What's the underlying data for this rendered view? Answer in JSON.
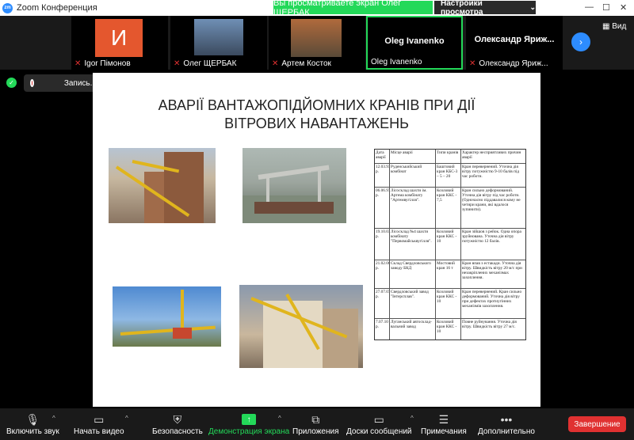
{
  "window": {
    "title": "Zoom Конференция",
    "app_icon": "zm"
  },
  "share_banner": "Вы просматриваете экран Олег ЩЕРБАК",
  "view_settings": "Настройки просмотра",
  "view_label": "Вид",
  "participants": [
    {
      "name": "Igor Пімонов",
      "initial": "И",
      "muted": true
    },
    {
      "name": "Олег ЩЕРБАК",
      "muted": true
    },
    {
      "name": "Артем Косток",
      "muted": true
    },
    {
      "name": "Oleg Ivanenko",
      "display": "Oleg Ivanenko",
      "muted": false
    },
    {
      "name": "Олександр Яриж...",
      "display": "Олександр Яриж...",
      "caption": "Олександр Яриж..."
    }
  ],
  "participant_labels": {
    "p4_caption": "Oleg Ivanenko",
    "p5_caption": "Олександр Яриж..."
  },
  "recording": {
    "label": "Запись..."
  },
  "slide": {
    "title_line1": "АВАРІЇ ВАНТАЖОПІДЙОМНИХ КРАНІВ ПРИ ДІЇ",
    "title_line2": "ВІТРОВИХ НАВАНТАЖЕНЬ",
    "table": {
      "headers": [
        "Дата аварії",
        "Місце аварії",
        "Типи кранів",
        "Характер несприятливих причин аварії"
      ],
      "rows": [
        [
          "12.03.93 р.",
          "Руденськийський комбінат",
          "Баштовий кран КБС-3 – 5 – 20",
          "Кран перевернений. Уточна дія вітру потужністю 9-10 балів під час роботи."
        ],
        [
          "06.06.97 р.",
          "Лісосклад шахти ім. Артема комбінату \"Артемвугілля\".",
          "Козловий кран ККС - 7,5",
          "Кран сильно деформований. Уточна дія вітру під час роботи. (Одночасно піддавалися кому не четири крани, які вдалося зупинити)."
        ],
        [
          "19.10.03 р.",
          "Лісосклад №4 шахти комбінату \"Первомайськвугілля\".",
          "Козловий кран ККС - 10",
          "Кран зійшов з рейок. Одна опора зруйнована. Уточна дія вітру потужністю 12 балів."
        ],
        [
          "21.02.06 р.",
          "Склад Свердловського заводу БКД",
          "Мостовий кран 16 т",
          "Кран впав з естакади. Уточна дія вітру. Швидкість вітру 20 м/с при незакріплених механізмах захоплення."
        ],
        [
          "27.07.07 р.",
          "Свердловський завод \"Інтерсплав\".",
          "Козловий кран ККС - 10",
          "Кран перевернений. Кран сильно деформований. Уточна дія вітру при дефектах протиугінних механізмів захоплення."
        ],
        [
          "7.07.10 р.",
          "Луганський автосклад-вальний завод",
          "Козловий кран ККС - 10",
          "Повне руйнування. Уточна дія вітру. Швидкість вітру 27 м/с."
        ]
      ]
    }
  },
  "toolbar": {
    "mic": "Включить звук",
    "video": "Начать видео",
    "security": "Безопасность",
    "share": "Демонстрация экрана",
    "apps": "Приложения",
    "whiteboard": "Доски сообщений",
    "notes": "Примечания",
    "more": "Дополнительно",
    "end": "Завершение"
  },
  "colors": {
    "accent_green": "#23d959",
    "accent_blue": "#2d8cff",
    "end_red": "#e03131"
  }
}
